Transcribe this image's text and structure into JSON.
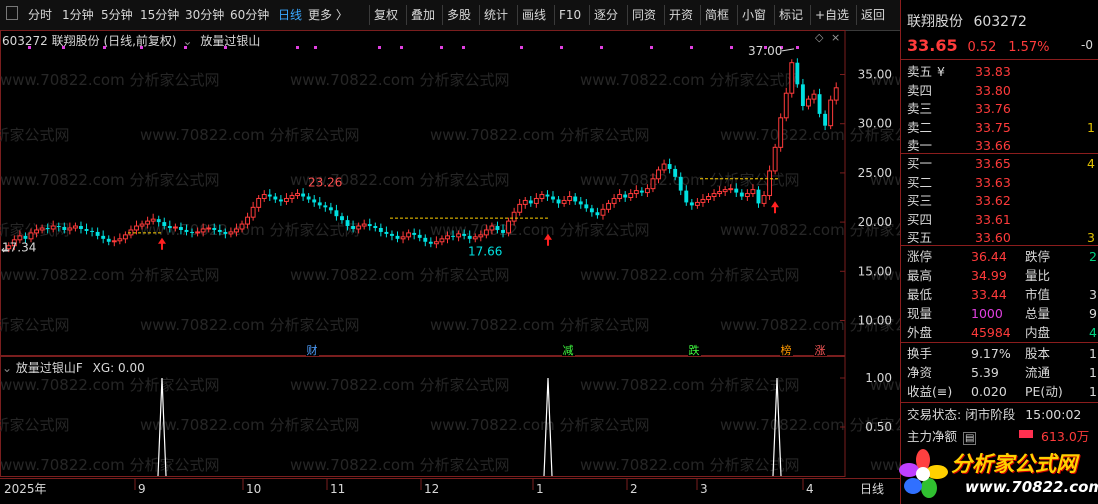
{
  "toolbar": {
    "left_items": [
      {
        "label": "分时"
      },
      {
        "label": "1分钟"
      },
      {
        "label": "5分钟"
      },
      {
        "label": "15分钟"
      },
      {
        "label": "30分钟"
      },
      {
        "label": "60分钟"
      },
      {
        "label": "日线"
      },
      {
        "label": "更多 〉"
      }
    ],
    "right_items": [
      {
        "label": "复权"
      },
      {
        "label": "叠加"
      },
      {
        "label": "多股"
      },
      {
        "label": "统计"
      },
      {
        "label": "画线"
      },
      {
        "label": "F10"
      },
      {
        "label": "逐分"
      },
      {
        "label": "同资"
      },
      {
        "label": "开资"
      },
      {
        "label": "简框"
      },
      {
        "label": "小窗"
      },
      {
        "label": "标记"
      },
      {
        "label": "+自选"
      },
      {
        "label": "返回"
      }
    ],
    "active_index": 6,
    "min_box": "□",
    "close_icon": "×"
  },
  "chart": {
    "header": "603272  联翔股份 (日线,前复权)",
    "indicator_name": "放量过银山",
    "sub_header_name": "放量过银山F",
    "sub_header_value": "XG: 0.00",
    "watermark": "www.70822.com  分析家公式网",
    "price_axis": [
      "35.00",
      "30.00",
      "25.00",
      "20.00",
      "15.00",
      "10.00"
    ],
    "sub_axis": [
      "1.00",
      "0.50"
    ],
    "time_axis": [
      "2025年",
      "9",
      "10",
      "11",
      "12",
      "1",
      "2",
      "3",
      "4"
    ],
    "period_label": "日线",
    "annotations": {
      "high": "23.26",
      "low_left": "17.34",
      "low_mid": "17.66",
      "last_high": "37.00"
    },
    "events": [
      {
        "text": "财",
        "color": "#4fa0ff"
      },
      {
        "text": "减",
        "color": "#40ff40"
      },
      {
        "text": "跌",
        "color": "#40ff40"
      },
      {
        "text": "榜",
        "color": "#ff9900"
      },
      {
        "text": "涨",
        "color": "#ff5a5a"
      }
    ],
    "up_color": "#ff3b3b",
    "down_color": "#00e0e0"
  },
  "chart_data": {
    "type": "candlestick",
    "dates_axis_labels": [
      "2025年",
      "9",
      "10",
      "11",
      "12",
      "1",
      "2",
      "3",
      "4"
    ],
    "ylim": [
      7,
      38
    ],
    "close": [
      17.6,
      18.2,
      18.6,
      18.3,
      18.9,
      19.2,
      19.4,
      19.3,
      19.6,
      19.5,
      19.2,
      19.4,
      19.6,
      19.3,
      19.1,
      19.0,
      18.6,
      18.3,
      18.0,
      18.1,
      18.3,
      18.7,
      19.2,
      19.6,
      19.8,
      20.1,
      20.3,
      20.0,
      19.6,
      19.4,
      19.5,
      19.2,
      19.0,
      18.9,
      19.0,
      19.3,
      19.4,
      19.2,
      19.0,
      18.8,
      19.0,
      19.3,
      19.8,
      20.5,
      21.5,
      22.4,
      22.8,
      22.6,
      22.3,
      22.1,
      22.4,
      22.7,
      22.9,
      22.6,
      22.3,
      22.0,
      21.7,
      21.5,
      21.2,
      20.6,
      20.2,
      19.6,
      19.3,
      19.6,
      19.8,
      19.6,
      19.4,
      19.0,
      18.8,
      18.6,
      18.3,
      18.5,
      18.9,
      18.7,
      18.4,
      18.0,
      17.8,
      18.0,
      18.3,
      18.6,
      18.5,
      18.8,
      18.6,
      18.3,
      18.5,
      18.7,
      19.2,
      19.6,
      19.2,
      18.9,
      20.1,
      21.0,
      21.8,
      22.2,
      21.9,
      22.4,
      22.8,
      22.6,
      22.3,
      21.9,
      22.2,
      22.6,
      22.1,
      21.8,
      21.4,
      21.0,
      20.7,
      21.3,
      21.9,
      22.4,
      22.8,
      22.5,
      22.9,
      23.2,
      23.0,
      23.4,
      24.4,
      25.3,
      25.9,
      25.4,
      24.6,
      23.2,
      22.0,
      21.7,
      22.0,
      22.3,
      22.6,
      22.9,
      23.1,
      23.3,
      23.4,
      23.0,
      22.6,
      22.9,
      23.3,
      21.9,
      22.7,
      25.2,
      27.6,
      30.6,
      33.1,
      36.2,
      34.0,
      31.8,
      32.5,
      33.0,
      31.0,
      29.8,
      32.4,
      33.65
    ]
  },
  "panel": {
    "name": "联翔股份",
    "code": "603272",
    "price": "33.65",
    "change": "0.52",
    "change_pct": "1.57%",
    "corner": "-0",
    "asks": [
      {
        "label": "卖五",
        "mark": "¥",
        "price": "33.83",
        "vol": ""
      },
      {
        "label": "卖四",
        "mark": "",
        "price": "33.80",
        "vol": ""
      },
      {
        "label": "卖三",
        "mark": "",
        "price": "33.76",
        "vol": ""
      },
      {
        "label": "卖二",
        "mark": "",
        "price": "33.75",
        "vol": "1"
      },
      {
        "label": "卖一",
        "mark": "",
        "price": "33.66",
        "vol": ""
      }
    ],
    "bids": [
      {
        "label": "买一",
        "price": "33.65",
        "vol": "4"
      },
      {
        "label": "买二",
        "price": "33.63",
        "vol": ""
      },
      {
        "label": "买三",
        "price": "33.62",
        "vol": ""
      },
      {
        "label": "买四",
        "price": "33.61",
        "vol": ""
      },
      {
        "label": "买五",
        "price": "33.60",
        "vol": "3"
      }
    ],
    "stats": [
      {
        "l1": "涨停",
        "v1": "36.44",
        "c1": "red",
        "l2": "跌停",
        "v2": "2",
        "c2": "green"
      },
      {
        "l1": "最高",
        "v1": "34.99",
        "c1": "red",
        "l2": "量比",
        "v2": "",
        "c2": "wht"
      },
      {
        "l1": "最低",
        "v1": "33.44",
        "c1": "red",
        "l2": "市值",
        "v2": "3",
        "c2": "wht"
      },
      {
        "l1": "现量",
        "v1": "1000",
        "c1": "mag",
        "l2": "总量",
        "v2": "9",
        "c2": "wht"
      },
      {
        "l1": "外盘",
        "v1": "45984",
        "c1": "red",
        "l2": "内盘",
        "v2": "4",
        "c2": "green"
      }
    ],
    "stats2": [
      {
        "l1": "换手",
        "v1": "9.17%",
        "c1": "wht",
        "l2": "股本",
        "v2": "1",
        "c2": "wht"
      },
      {
        "l1": "净资",
        "v1": "5.39",
        "c1": "wht",
        "l2": "流通",
        "v2": "1",
        "c2": "wht"
      },
      {
        "l1": "收益(≡)",
        "v1": "0.020",
        "c1": "wht",
        "l2": "PE(动)",
        "v2": "1",
        "c2": "wht"
      }
    ],
    "trade_status_label": "交易状态:",
    "trade_status": "闭市阶段",
    "trade_time": "15:00:02",
    "main_flow_label": "主力净额",
    "main_flow": "613.0万",
    "logo_text": "分析家公式网",
    "logo_url": "www.70822.com"
  }
}
